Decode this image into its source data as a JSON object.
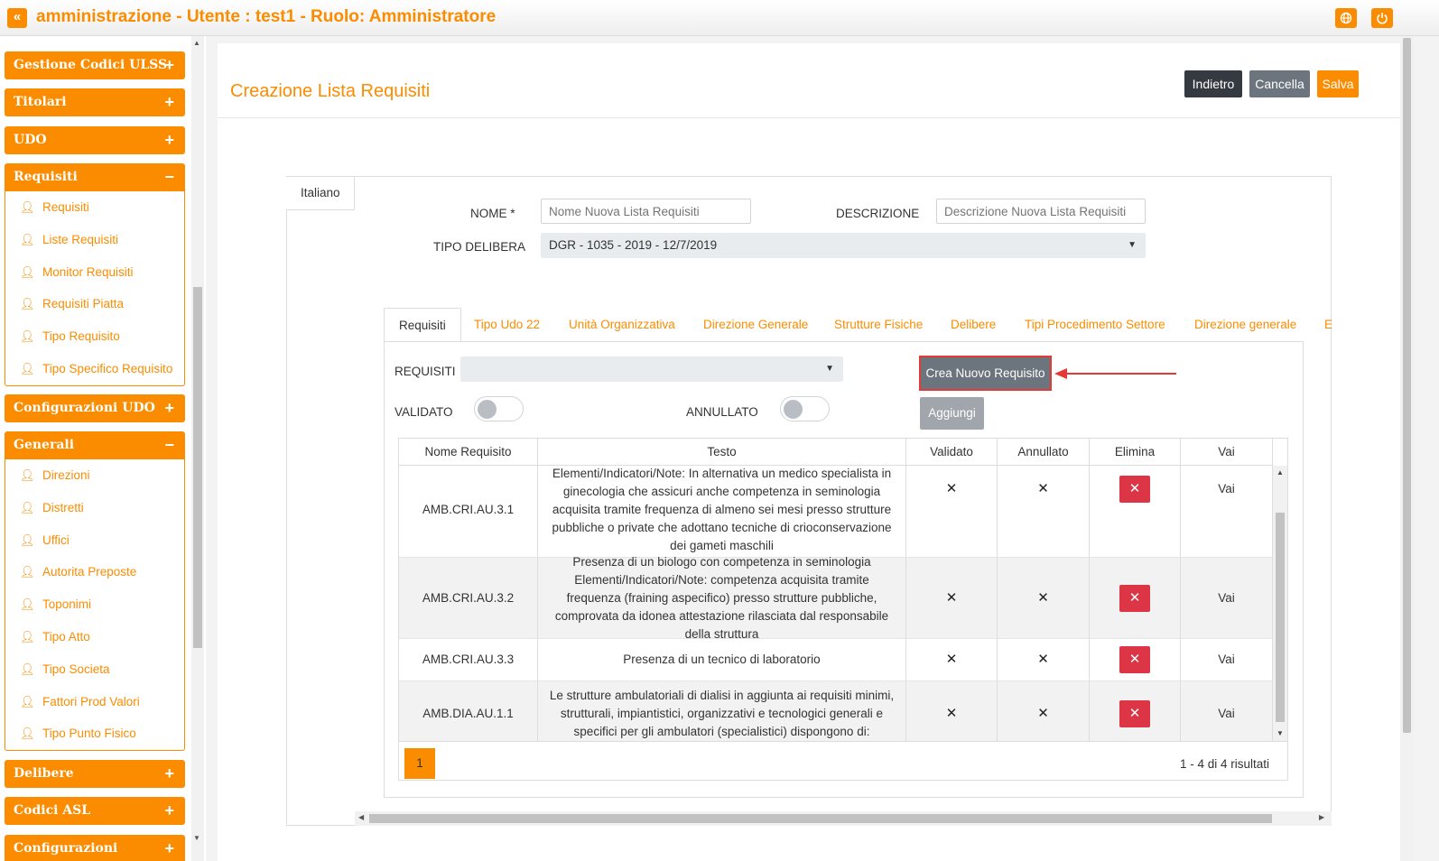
{
  "header": {
    "collapse_icon": "«",
    "title": "amministrazione - Utente : test1 - Ruolo: Amministratore",
    "globe_icon": "globe-icon",
    "power_icon": "power-icon"
  },
  "sidebar": {
    "groups": [
      {
        "label": "Gestione Codici ULSS",
        "sign": "+"
      },
      {
        "label": "Titolari",
        "sign": "+"
      },
      {
        "label": "UDO",
        "sign": "+"
      },
      {
        "label": "Requisiti",
        "sign": "−",
        "items": [
          "Requisiti",
          "Liste Requisiti",
          "Monitor Requisiti",
          "Requisiti Piatta",
          "Tipo Requisito",
          "Tipo Specifico Requisito"
        ]
      },
      {
        "label": "Configurazioni UDO",
        "sign": "+"
      },
      {
        "label": "Generali",
        "sign": "−",
        "items": [
          "Direzioni",
          "Distretti",
          "Uffici",
          "Autorita Preposte",
          "Toponimi",
          "Tipo Atto",
          "Tipo Societa",
          "Fattori Prod Valori",
          "Tipo Punto Fisico"
        ]
      },
      {
        "label": "Delibere",
        "sign": "+"
      },
      {
        "label": "Codici ASL",
        "sign": "+"
      },
      {
        "label": "Configurazioni",
        "sign": "+"
      }
    ]
  },
  "page": {
    "title": "Creazione Lista Requisiti",
    "buttons": {
      "back": "Indietro",
      "cancel": "Cancella",
      "save": "Salva"
    },
    "language_tab": "Italiano",
    "form": {
      "nome_label": "NOME *",
      "nome_placeholder": "Nome Nuova Lista Requisiti",
      "descrizione_label": "DESCRIZIONE",
      "descrizione_placeholder": "Descrizione Nuova Lista Requisiti",
      "tipo_delibera_label": "TIPO DELIBERA",
      "tipo_delibera_value": "DGR - 1035 - 2019 - 12/7/2019"
    },
    "tabs": [
      "Requisiti",
      "Tipo Udo 22",
      "Unità Organizzativa",
      "Direzione Generale",
      "Strutture Fisiche",
      "Delibere",
      "Tipi Procedimento Settore",
      "Direzione generale",
      "E"
    ],
    "requisiti_panel": {
      "requisiti_label": "REQUISITI",
      "requisiti_value": "",
      "validato_label": "VALIDATO",
      "annullato_label": "ANNULLATO",
      "create_button": "Crea Nuovo Requisito",
      "add_button": "Aggiungi",
      "table": {
        "columns": [
          "Nome Requisito",
          "Testo",
          "Validato",
          "Annullato",
          "Elimina",
          "Vai"
        ],
        "rows": [
          {
            "nome": "AMB.CRI.AU.3.1",
            "testo": "Elementi/Indicatori/Note: In alternativa un medico specialista in ginecologia che assicuri anche competenza in seminologia acquisita tramite frequenza di almeno sei mesi presso strutture pubbliche o private che adottano tecniche di crioconservazione dei gameti maschili",
            "validato": "✕",
            "annullato": "✕",
            "elimina": "✕",
            "vai": "Vai"
          },
          {
            "nome": "AMB.CRI.AU.3.2",
            "testo": "Presenza di un biologo con competenza in seminologia Elementi/Indicatori/Note: competenza acquisita tramite frequenza (fraining aspecifico) presso strutture pubbliche, comprovata da idonea attestazione rilasciata dal responsabile della struttura",
            "validato": "✕",
            "annullato": "✕",
            "elimina": "✕",
            "vai": "Vai"
          },
          {
            "nome": "AMB.CRI.AU.3.3",
            "testo": "Presenza di un tecnico di laboratorio",
            "validato": "✕",
            "annullato": "✕",
            "elimina": "✕",
            "vai": "Vai"
          },
          {
            "nome": "AMB.DIA.AU.1.1",
            "testo": "Le strutture ambulatoriali di dialisi in aggiunta ai requisiti minimi, strutturali, impiantistici, organizzativi e tecnologici generali e specifici per gli ambulatori (specialistici) dispongono di:",
            "validato": "✕",
            "annullato": "✕",
            "elimina": "✕",
            "vai": "Vai"
          }
        ]
      },
      "pagination": {
        "page": "1",
        "results": "1 - 4 di 4 risultati"
      }
    }
  },
  "colors": {
    "accent": "#fb8c00",
    "danger": "#dc3545",
    "highlight": "#e53935"
  }
}
